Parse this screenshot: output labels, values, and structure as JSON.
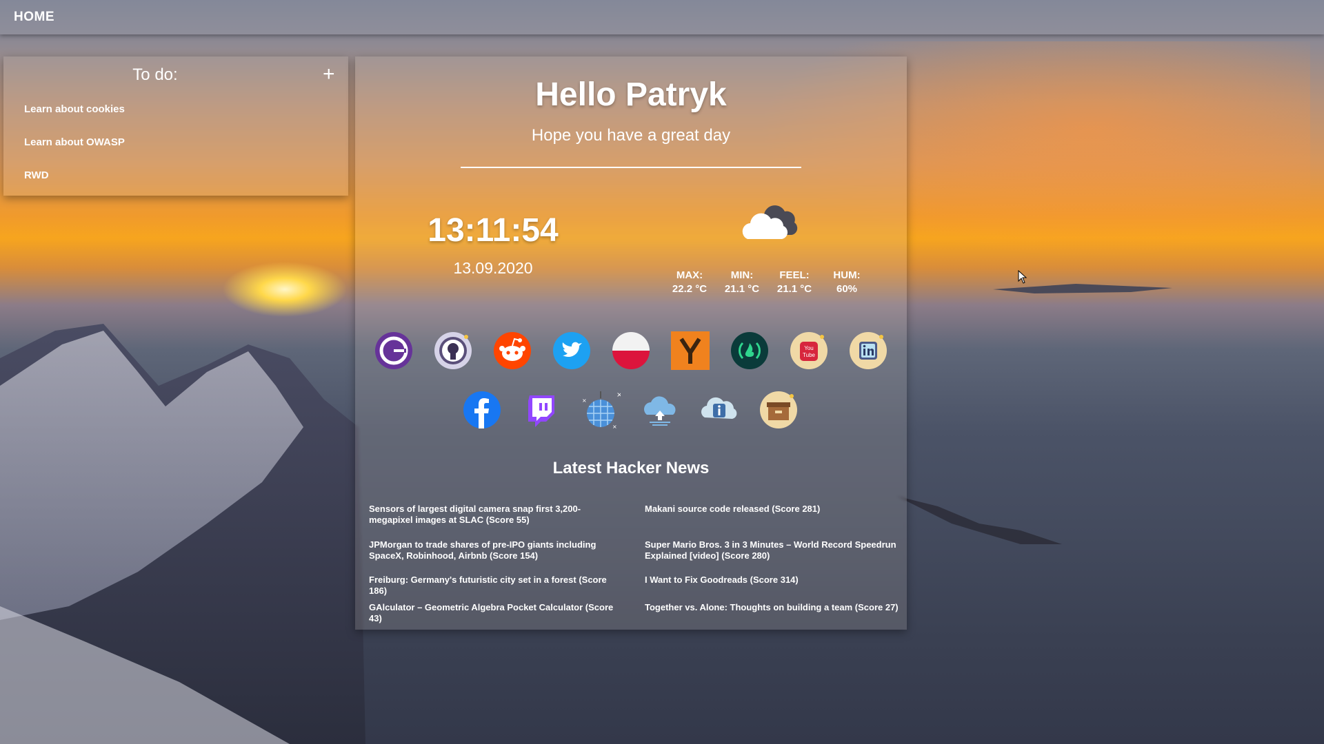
{
  "nav": {
    "home_label": "HOME"
  },
  "todo": {
    "title": "To do:",
    "add_label": "+",
    "items": [
      "Learn about cookies",
      "Learn about OWASP",
      "RWD"
    ]
  },
  "greeting": {
    "title": "Hello Patryk",
    "subtitle": "Hope you have a great day"
  },
  "clock": {
    "time": "13:11:54",
    "date": "13.09.2020"
  },
  "weather": {
    "icon": "cloud-icon",
    "stats": [
      {
        "label": "MAX:",
        "value": "22.2 °C"
      },
      {
        "label": "MIN:",
        "value": "21.1 °C"
      },
      {
        "label": "FEEL:",
        "value": "21.1 °C"
      },
      {
        "label": "HUM:",
        "value": "60%"
      }
    ]
  },
  "links": [
    {
      "name": "gatsby-icon",
      "color": "#663399"
    },
    {
      "name": "github-icon",
      "color": "#d6d3e8"
    },
    {
      "name": "reddit-icon",
      "color": "#ff4500"
    },
    {
      "name": "twitter-icon",
      "color": "#1da1f2"
    },
    {
      "name": "poland-flag-icon",
      "color": "#dc143c"
    },
    {
      "name": "hacker-news-icon",
      "color": "#f0821e"
    },
    {
      "name": "freecodecamp-icon",
      "color": "#0a3b3a"
    },
    {
      "name": "youtube-icon",
      "color": "#f0d9a6"
    },
    {
      "name": "linkedin-icon",
      "color": "#f0d9a6"
    },
    {
      "name": "facebook-icon",
      "color": "#1877f2"
    },
    {
      "name": "twitch-icon",
      "color": "#9146ff"
    },
    {
      "name": "disco-ball-icon",
      "color": "#4a90d9"
    },
    {
      "name": "cloud-upload-icon",
      "color": "#7fb8e6"
    },
    {
      "name": "info-cloud-icon",
      "color": "#cfe3ee"
    },
    {
      "name": "archive-box-icon",
      "color": "#f0d9a6"
    }
  ],
  "hacker_news": {
    "title": "Latest Hacker News",
    "items": [
      "Sensors of largest digital camera snap first 3,200-megapixel images at SLAC (Score 55)",
      "Makani source code released (Score 281)",
      "JPMorgan to trade shares of pre-IPO giants including SpaceX, Robinhood, Airbnb (Score 154)",
      "Super Mario Bros. 3 in 3 Minutes – World Record Speedrun Explained [video] (Score 280)",
      "Freiburg: Germany's futuristic city set in a forest (Score 186)",
      "I Want to Fix Goodreads (Score 314)",
      "GAlculator – Geometric Algebra Pocket Calculator (Score 43)",
      "Together vs. Alone: Thoughts on building a team (Score 27)"
    ]
  }
}
